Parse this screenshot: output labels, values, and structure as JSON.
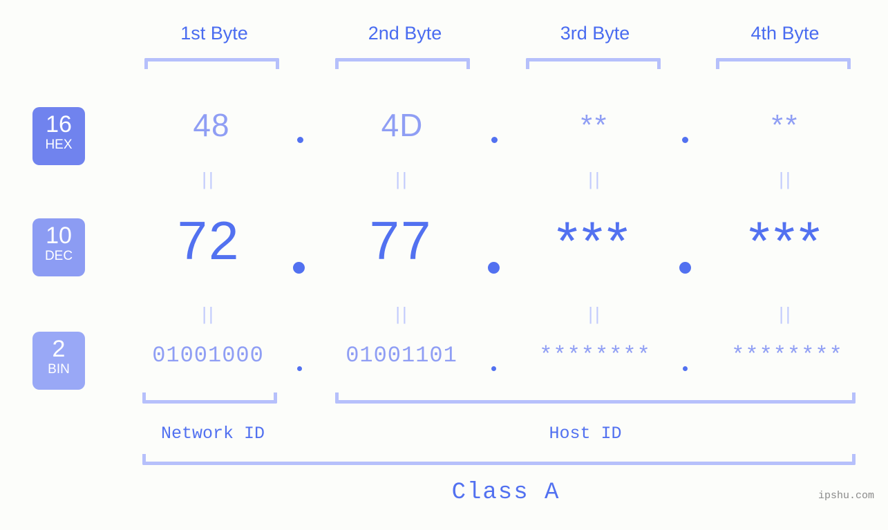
{
  "background_color": "#fcfdfa",
  "accent_color": "#5271f0",
  "muted_color": "#8f9ef4",
  "bracket_color": "#b6c0fb",
  "header": {
    "byte_labels": [
      "1st Byte",
      "2nd Byte",
      "3rd Byte",
      "4th Byte"
    ]
  },
  "radix_badges": [
    {
      "number": "16",
      "name": "HEX",
      "color": "#7083ee"
    },
    {
      "number": "10",
      "name": "DEC",
      "color": "#8c9cf3"
    },
    {
      "number": "2",
      "name": "BIN",
      "color": "#99a8f6"
    }
  ],
  "rows": {
    "hex": {
      "values": [
        "48",
        "4D",
        "**",
        "**"
      ]
    },
    "dec": {
      "values": [
        "72",
        "77",
        "***",
        "***"
      ]
    },
    "bin": {
      "values": [
        "01001000",
        "01001101",
        "********",
        "********"
      ]
    }
  },
  "separator": ".",
  "equals_symbol": "||",
  "segments": {
    "network_id_label": "Network ID",
    "host_id_label": "Host ID",
    "class_label": "Class A"
  },
  "watermark": "ipshu.com"
}
